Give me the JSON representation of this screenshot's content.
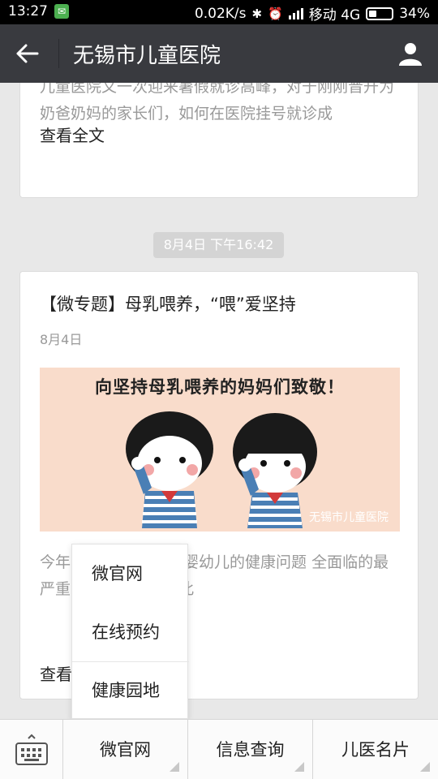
{
  "status_bar": {
    "time": "13:27",
    "net_speed": "0.02K/s",
    "carrier": "移动 4G",
    "battery": "34%",
    "battery_level": 0.34
  },
  "header": {
    "title": "无锡市儿童医院"
  },
  "cards": [
    {
      "summary": "儿童医院又一次迎来暑假就诊高峰，对于刚刚晋升为奶爸奶妈的家长们，如何在医院挂号就诊成",
      "read_more": "查看全文"
    },
    {
      "timestamp": "8月4日 下午16:42",
      "title": "【微专题】母乳喂养，“喂”爱坚持",
      "date": "8月4日",
      "banner_title": "向坚持母乳喂养的妈妈们致敬！",
      "banner_watermark": "无锡市儿童医院",
      "summary": "今年 母乳喂养周，而婴幼儿的健康问题 全面临的最严重的挑战之一，因此",
      "read_more": "查看"
    }
  ],
  "popup_menu": {
    "items": [
      "微官网",
      "在线预约",
      "健康园地"
    ]
  },
  "bottom_menu": {
    "items": [
      "微官网",
      "信息查询",
      "儿医名片"
    ]
  },
  "colors": {
    "title_bar": "#393a3f",
    "background": "#e8e8e8",
    "banner": "#f9dccb"
  }
}
